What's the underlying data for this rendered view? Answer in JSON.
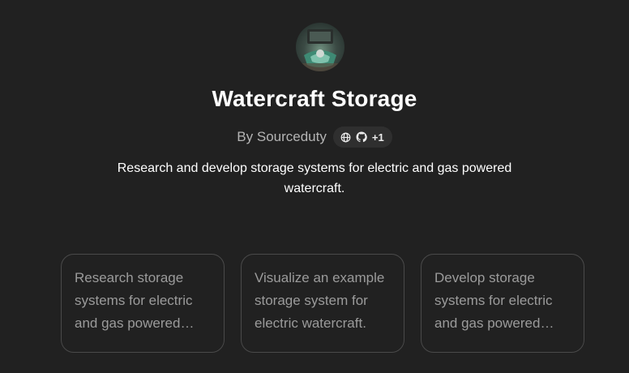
{
  "gpt": {
    "avatar_icon": "boat-storage-avatar",
    "title": "Watercraft Storage",
    "byline": "By Sourceduty",
    "badge": {
      "icons": [
        "globe-icon",
        "github-icon"
      ],
      "count": "+1"
    },
    "description": "Research and develop storage systems for electric and gas powered watercraft."
  },
  "conversation_starters": [
    {
      "text": "Research storage systems for electric and gas powered watercraft."
    },
    {
      "text": "Visualize an example storage system for electric watercraft."
    },
    {
      "text": "Develop storage systems for electric and gas powered watercraft."
    }
  ],
  "colors": {
    "background": "#212121",
    "title": "#ffffff",
    "muted_text": "#b4b4b4",
    "starter_text": "#9b9b9b",
    "starter_border": "#4a4a4a",
    "badge_bg": "#2f2f2f"
  }
}
